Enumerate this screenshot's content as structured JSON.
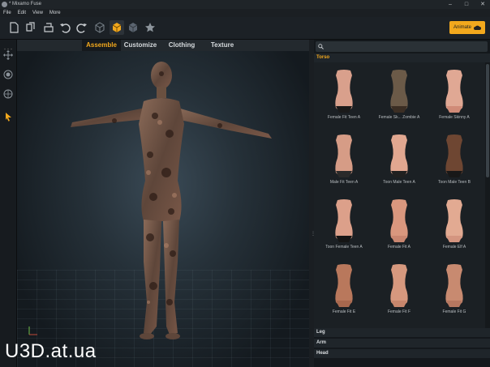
{
  "window": {
    "title": "* Mixamo Fuse",
    "controls": [
      "–",
      "□",
      "✕"
    ]
  },
  "menu": [
    "File",
    "Edit",
    "View",
    "More"
  ],
  "toolbar": {
    "animate_label": "Animate"
  },
  "tabs": [
    {
      "label": "Assemble",
      "active": true
    },
    {
      "label": "Customize",
      "active": false
    },
    {
      "label": "Clothing",
      "active": false
    },
    {
      "label": "Texture",
      "active": false
    }
  ],
  "search": {
    "placeholder": ""
  },
  "sections": {
    "torso": "Torso",
    "leg": "Leg",
    "arm": "Arm",
    "head": "Head"
  },
  "gallery": [
    {
      "label": "Female Fit Teen A",
      "skin": "#d9a08c",
      "garment": "#1a1a1a"
    },
    {
      "label": "Female Sk... Zombie A",
      "skin": "#6b5a48",
      "garment": "#3b2e24"
    },
    {
      "label": "Female Skinny A",
      "skin": "#e0a894",
      "garment": "#d08b78"
    },
    {
      "label": "Male Fit Teen A",
      "skin": "#d69c86",
      "garment": "#2a2a2a"
    },
    {
      "label": "Toon Male Teen A",
      "skin": "#e1a790",
      "garment": "#202020"
    },
    {
      "label": "Toon Male Teen B",
      "skin": "#6e4632",
      "garment": "#181818"
    },
    {
      "label": "Toon Female Teen A",
      "skin": "#dca08a",
      "garment": "#151515"
    },
    {
      "label": "Female Fit A",
      "skin": "#d9977e",
      "garment": "#c98670"
    },
    {
      "label": "Female Elf A",
      "skin": "#e2aa92",
      "garment": "#d49580"
    },
    {
      "label": "Female Fit E",
      "skin": "#b9785c",
      "garment": "#a8684e"
    },
    {
      "label": "Female Fit F",
      "skin": "#d6987e",
      "garment": "#c7866c"
    },
    {
      "label": "Female Fit G",
      "skin": "#c88a70",
      "garment": "#b57760"
    }
  ],
  "watermark": "U3D.at.ua",
  "colors": {
    "accent": "#f2a81d",
    "panel": "#1b2024",
    "viewport": "#253038"
  }
}
